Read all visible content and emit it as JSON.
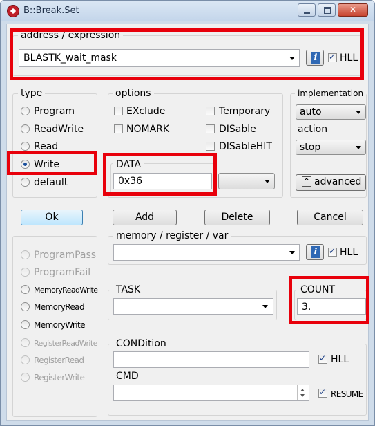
{
  "window": {
    "title": "B::Break.Set",
    "close_glyph": "✕"
  },
  "address": {
    "label": "address / expression",
    "value": "BLASTK_wait_mask",
    "info_glyph": "i",
    "hll_label": "HLL",
    "hll_checked": true
  },
  "type": {
    "label": "type",
    "options": [
      "Program",
      "ReadWrite",
      "Read",
      "Write",
      "default"
    ],
    "selected": "Write"
  },
  "options": {
    "label": "options",
    "exclude": "EXclude",
    "nomark": "NOMARK",
    "temporary": "Temporary",
    "disable": "DISable",
    "disablehit": "DISableHIT"
  },
  "implementation": {
    "label": "implementation",
    "value": "auto"
  },
  "action": {
    "label": "action",
    "value": "stop"
  },
  "advanced": {
    "label": "advanced",
    "icon_glyph": "⌃"
  },
  "data": {
    "label": "DATA",
    "value": "0x36",
    "format": ""
  },
  "buttons": {
    "ok": "Ok",
    "add": "Add",
    "delete": "Delete",
    "cancel": "Cancel"
  },
  "memory": {
    "label": "memory / register / var",
    "value": "",
    "hll_label": "HLL",
    "hll_checked": true
  },
  "disabled_types": [
    "ProgramPass",
    "ProgramFail"
  ],
  "mem_types": [
    "MemoryReadWrite",
    "MemoryRead",
    "MemoryWrite"
  ],
  "reg_types": [
    "RegisterReadWrite",
    "RegisterRead",
    "RegisterWrite"
  ],
  "task": {
    "label": "TASK",
    "value": ""
  },
  "count": {
    "label": "COUNT",
    "value": "3."
  },
  "condition": {
    "label": "CONDition",
    "value": "",
    "hll_label": "HLL",
    "hll_checked": true
  },
  "cmd": {
    "label": "CMD",
    "value": "",
    "resume_label": "RESUME",
    "resume_checked": true
  },
  "colors": {
    "highlight": "#e8000b",
    "accent": "#3c7fb1"
  },
  "icons": [
    "app-icon",
    "minimize-icon",
    "maximize-icon",
    "close-icon",
    "info-icon",
    "dropdown-arrow-icon",
    "chevron-up-icon",
    "spinner-icon"
  ]
}
